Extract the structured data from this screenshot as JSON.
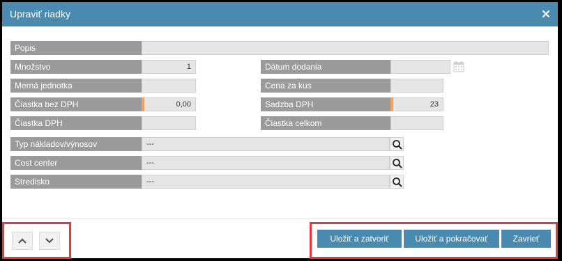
{
  "dialog": {
    "title": "Upraviť riadky",
    "close_icon": "close-icon"
  },
  "form": {
    "popis": {
      "label": "Popis",
      "value": ""
    },
    "mnozstvo": {
      "label": "Množstvo",
      "value": "1"
    },
    "merna_jednotka": {
      "label": "Merná jednotka",
      "value": ""
    },
    "ciastka_bez_dph": {
      "label": "Čiastka bez DPH",
      "value": "0,00"
    },
    "ciastka_dph": {
      "label": "Čiastka DPH",
      "value": ""
    },
    "datum_dodania": {
      "label": "Dátum dodania",
      "value": "",
      "icon": "calendar-icon"
    },
    "cena_za_kus": {
      "label": "Cena za kus",
      "value": ""
    },
    "sadzba_dph": {
      "label": "Sadzba DPH",
      "value": "23"
    },
    "ciastka_celkom": {
      "label": "Čiastka celkom",
      "value": ""
    },
    "typ_nakladov": {
      "label": "Typ nákladov/výnosov",
      "value": "---",
      "icon": "search-icon"
    },
    "cost_center": {
      "label": "Cost center",
      "value": "---",
      "icon": "search-icon"
    },
    "stredisko": {
      "label": "Stredisko",
      "value": "---",
      "icon": "search-icon"
    }
  },
  "footer": {
    "nav_up_icon": "chevron-up-icon",
    "nav_down_icon": "chevron-down-icon",
    "save_close": "Uložiť a zatvoriť",
    "save_continue": "Uložiť a pokračovať",
    "close": "Zavrieť"
  },
  "colors": {
    "header": "#4b8ab0",
    "label_bg": "#9a9a9a",
    "field_bg": "#e5e5e5",
    "highlight": "#e8363f",
    "required_marker": "#f0a060"
  }
}
